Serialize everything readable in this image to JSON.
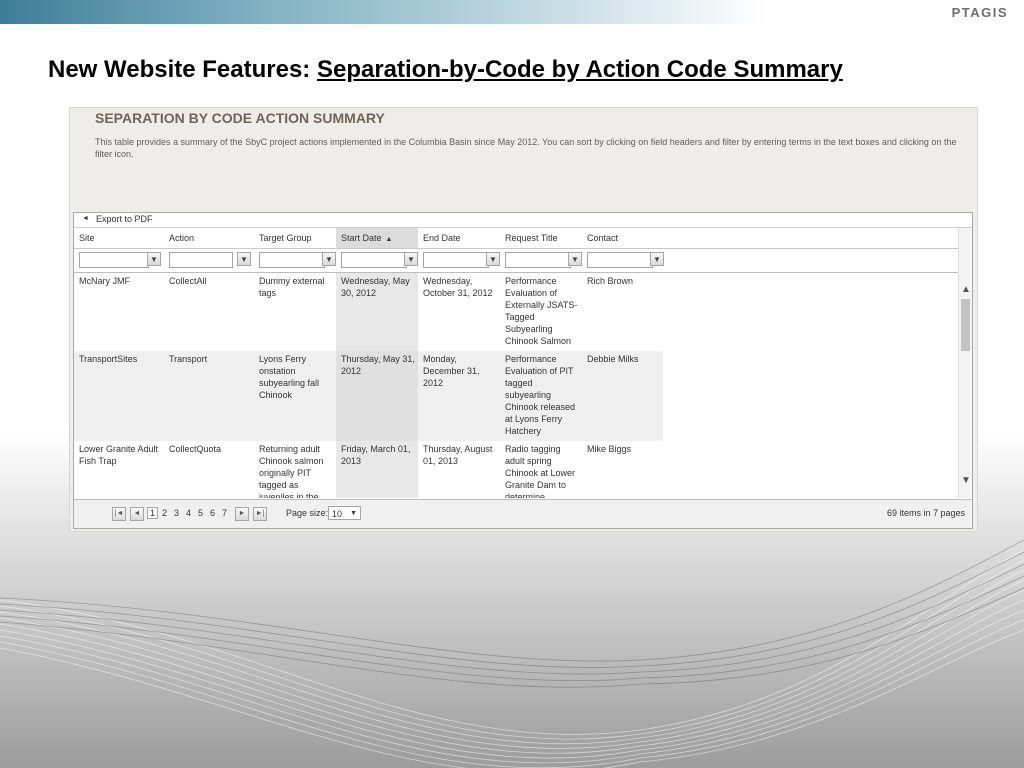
{
  "brand": {
    "logo": "PTAGIS"
  },
  "slide": {
    "title_prefix": "New Website Features: ",
    "title_main": "Separation-by-Code by Action Code Summary"
  },
  "panel": {
    "heading": "SEPARATION BY CODE ACTION SUMMARY",
    "description": "This table provides a summary of the SbyC project actions implemented in the Columbia Basin since May 2012. You can sort by clicking on field headers and filter by entering terms in the text boxes and clicking on the filter icon."
  },
  "toolbar": {
    "export_label": "Export to PDF",
    "export_icon": "arrow-icon"
  },
  "table": {
    "columns": [
      "Site",
      "Action",
      "Target Group",
      "Start Date",
      "End Date",
      "Request Title",
      "Contact"
    ],
    "sorted_column": "Start Date",
    "sort_direction": "ascending",
    "rows": [
      {
        "site": "McNary JMF",
        "action": "CollectAll",
        "target_group": "Dummy external tags",
        "start_date": "Wednesday, May 30, 2012",
        "end_date": "Wednesday, October 31, 2012",
        "request_title": "Performance Evaluation of Externally JSATS-Tagged Subyearling Chinook Salmon",
        "contact": "Rich Brown"
      },
      {
        "site": "TransportSites",
        "action": "Transport",
        "target_group": "Lyons Ferry onstation subyearling fall Chinook",
        "start_date": "Thursday, May 31, 2012",
        "end_date": "Monday, December 31, 2012",
        "request_title": "Performance Evaluation of PIT tagged subyearling Chinook released at Lyons Ferry Hatchery",
        "contact": "Debbie Milks"
      },
      {
        "site": "Lower Granite Adult Fish Trap",
        "action": "CollectQuota",
        "target_group": "Returning adult Chinook salmon originally PIT tagged as juveniles in the",
        "start_date": "Friday, March 01, 2013",
        "end_date": "Thursday, August 01, 2013",
        "request_title": "Radio tagging adult spring Chinook at Lower Granite Dam to determine",
        "contact": "Mike Biggs"
      }
    ]
  },
  "pager": {
    "pages": [
      "1",
      "2",
      "3",
      "4",
      "5",
      "6",
      "7"
    ],
    "current_page": "1",
    "page_size_label": "Page size:",
    "page_size": "10",
    "summary": "69 items in 7 pages"
  }
}
